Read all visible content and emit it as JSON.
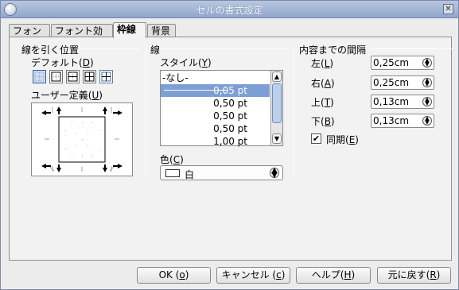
{
  "window": {
    "title": "セルの書式設定",
    "close_glyph": "✕"
  },
  "tabs": [
    {
      "label": "フォント"
    },
    {
      "label": "フォント効果"
    },
    {
      "label": "枠線",
      "active": true
    },
    {
      "label": "背景"
    }
  ],
  "line_arrangement": {
    "title": "線を引く位置",
    "default_label": "デフォルト(",
    "default_mnemonic": "D",
    "default_suffix": ")",
    "user_defined_label": "ユーザー定義(",
    "user_defined_mnemonic": "U",
    "user_defined_suffix": ")"
  },
  "line": {
    "title": "線",
    "style_label": "スタイル(",
    "style_mnemonic": "Y",
    "style_suffix": ")",
    "styles": [
      "-なし-",
      "0,05 pt",
      "0,50 pt",
      "0,50 pt",
      "0,50 pt",
      "1,00 pt"
    ],
    "selected_index": 1,
    "color_label": "色(",
    "color_mnemonic": "C",
    "color_suffix": ")",
    "color_value": "白",
    "selection_color": "#7d9fd3"
  },
  "spacing": {
    "title": "内容までの間隔",
    "left_label": "左(",
    "left_mnemonic": "L",
    "left_value": "0,25cm",
    "right_label": "右(",
    "right_mnemonic": "A",
    "right_value": "0,25cm",
    "top_label": "上(",
    "top_mnemonic": "T",
    "top_value": "0,13cm",
    "bottom_label": "下(",
    "bottom_mnemonic": "B",
    "bottom_value": "0,13cm",
    "close_paren": ")",
    "sync_label": "同期(",
    "sync_mnemonic": "E",
    "sync_suffix": ")",
    "sync_checked": true,
    "check_glyph": "✔"
  },
  "buttons": {
    "ok": "OK (",
    "ok_mnemonic": "o",
    "ok_suffix": ")",
    "cancel": "キャンセル (",
    "cancel_mnemonic": "c",
    "cancel_suffix": ")",
    "help": "ヘルプ(",
    "help_mnemonic": "H",
    "help_suffix": ")",
    "reset": "元に戻す(",
    "reset_mnemonic": "R",
    "reset_suffix": ")"
  }
}
